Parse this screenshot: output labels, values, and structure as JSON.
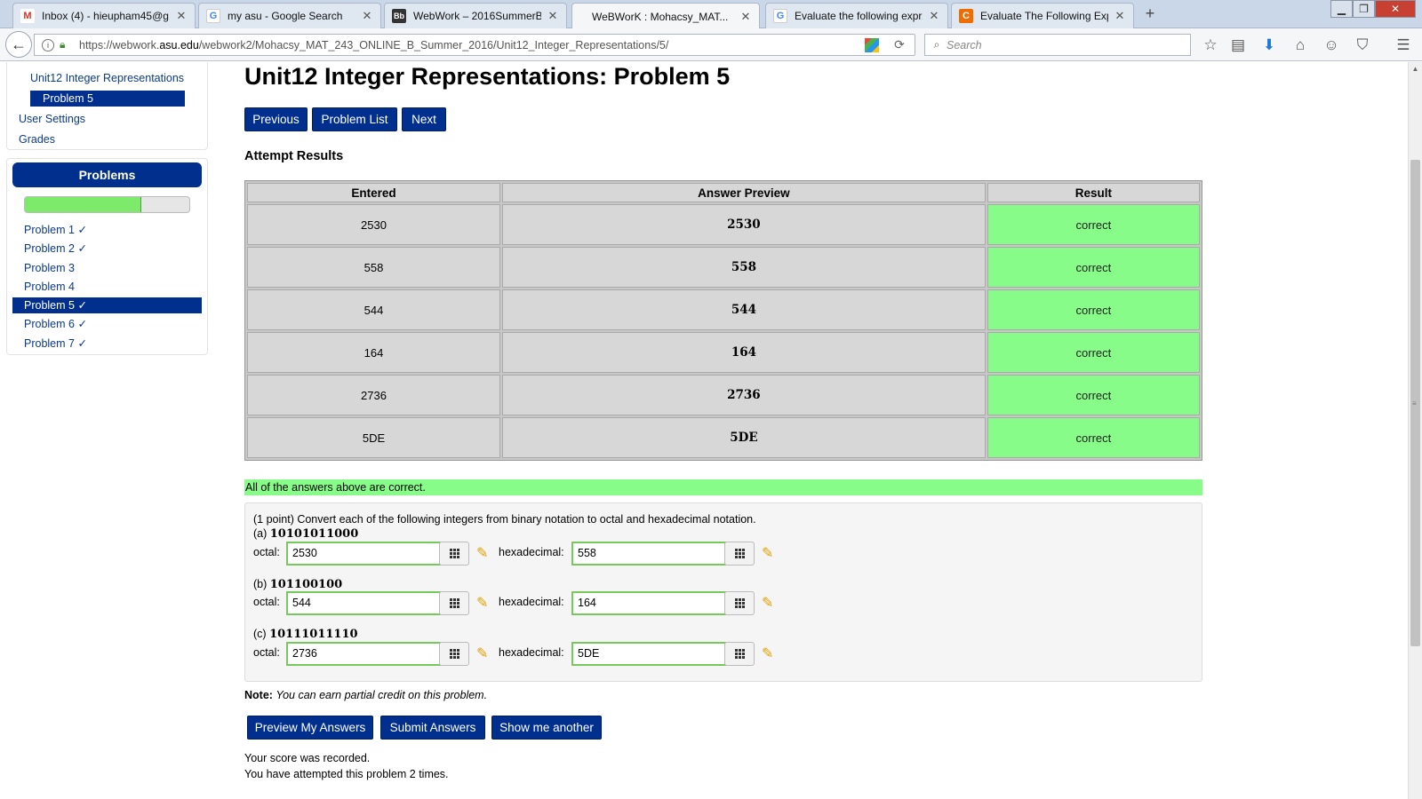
{
  "browser": {
    "tabs": [
      {
        "label": "Inbox (4) - hieupham45@g...",
        "icon": "gmail-icon",
        "active": false
      },
      {
        "label": "my asu - Google Search",
        "icon": "google-icon",
        "active": false
      },
      {
        "label": "WebWork – 2016SummerB...",
        "icon": "blackboard-icon",
        "active": false
      },
      {
        "label": "WeBWorK : Mohacsy_MAT...",
        "icon": "none",
        "active": true
      },
      {
        "label": "Evaluate the following expr...",
        "icon": "google-icon",
        "active": false
      },
      {
        "label": "Evaluate The Following Exp...",
        "icon": "chegg-icon",
        "active": false
      }
    ],
    "new_tab": "+",
    "url_prefix": "https://webwork.",
    "url_domain": "asu.edu",
    "url_rest": "/webwork2/Mohacsy_MAT_243_ONLINE_B_Summer_2016/Unit12_Integer_Representations/5/",
    "search_placeholder": "Search"
  },
  "sidebar": {
    "links": [
      {
        "label": "Unit12 Integer Representations",
        "current": false
      },
      {
        "label": "Problem 5",
        "current": true
      },
      {
        "label": "User Settings",
        "current": false
      },
      {
        "label": "Grades",
        "current": false
      }
    ],
    "problems_header": "Problems",
    "progress_fraction": 0.71,
    "problems": [
      {
        "label": "Problem 1 ✓",
        "active": false
      },
      {
        "label": "Problem 2 ✓",
        "active": false
      },
      {
        "label": "Problem 3",
        "active": false
      },
      {
        "label": "Problem 4",
        "active": false
      },
      {
        "label": "Problem 5 ✓",
        "active": true
      },
      {
        "label": "Problem 6 ✓",
        "active": false
      },
      {
        "label": "Problem 7 ✓",
        "active": false
      }
    ]
  },
  "main": {
    "title": "Unit12 Integer Representations: Problem 5",
    "nav": {
      "previous": "Previous",
      "problem_list": "Problem List",
      "next": "Next"
    },
    "attempt_title": "Attempt Results",
    "results_headers": [
      "Entered",
      "Answer Preview",
      "Result"
    ],
    "results": [
      {
        "entered": "2530",
        "preview": "2530",
        "result": "correct"
      },
      {
        "entered": "558",
        "preview": "558",
        "result": "correct"
      },
      {
        "entered": "544",
        "preview": "544",
        "result": "correct"
      },
      {
        "entered": "164",
        "preview": "164",
        "result": "correct"
      },
      {
        "entered": "2736",
        "preview": "2736",
        "result": "correct"
      },
      {
        "entered": "5DE",
        "preview": "5DE",
        "result": "correct"
      }
    ],
    "all_correct": "All of the answers above are correct.",
    "problem": {
      "statement": "(1 point) Convert each of the following integers from binary notation to octal and hexadecimal notation.",
      "octal_label": "octal:",
      "hex_label": "hexadecimal:",
      "parts": [
        {
          "label": "(a)",
          "binary": "10101011000",
          "octal": "2530",
          "hex": "558"
        },
        {
          "label": "(b)",
          "binary": "101100100",
          "octal": "544",
          "hex": "164"
        },
        {
          "label": "(c)",
          "binary": "10111011110",
          "octal": "2736",
          "hex": "5DE"
        }
      ]
    },
    "note_label": "Note:",
    "note_text": "You can earn partial credit on this problem.",
    "actions": {
      "preview": "Preview My Answers",
      "submit": "Submit Answers",
      "another": "Show me another"
    },
    "status": [
      "Your score was recorded.",
      "You have attempted this problem 2 times."
    ]
  }
}
